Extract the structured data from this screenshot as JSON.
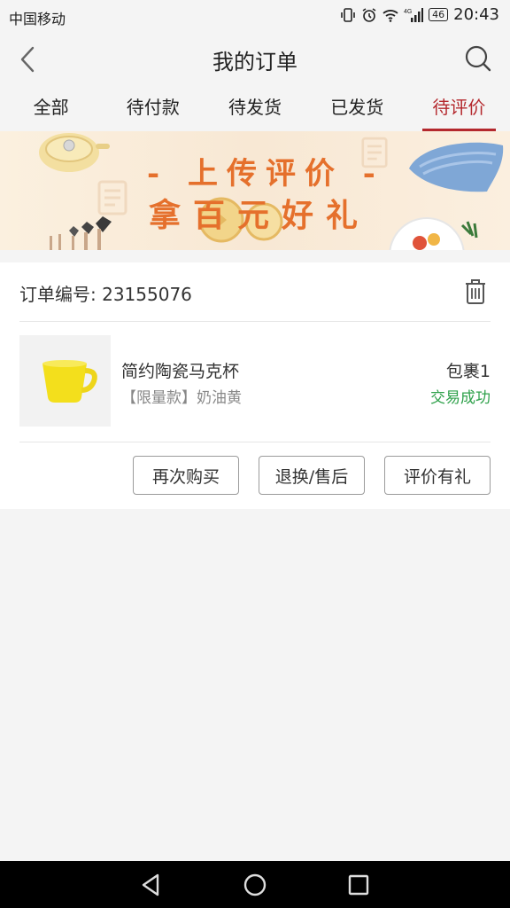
{
  "status_bar": {
    "carrier": "中国移动",
    "network": "4G",
    "battery": "46",
    "time": "20:43"
  },
  "header": {
    "title": "我的订单"
  },
  "tabs": [
    {
      "label": "全部",
      "active": false
    },
    {
      "label": "待付款",
      "active": false
    },
    {
      "label": "待发货",
      "active": false
    },
    {
      "label": "已发货",
      "active": false
    },
    {
      "label": "待评价",
      "active": true
    }
  ],
  "banner": {
    "line1": "- 上传评价 -",
    "line2": "拿百元好礼"
  },
  "order": {
    "number_label": "订单编号: 23155076",
    "item": {
      "name": "简约陶瓷马克杯",
      "spec": "【限量款】奶油黄",
      "package": "包裹1",
      "status": "交易成功"
    },
    "actions": {
      "rebuy": "再次购买",
      "return": "退换/售后",
      "review": "评价有礼"
    }
  },
  "colors": {
    "accent": "#b4282d",
    "banner_text": "#e5702c",
    "success": "#2fa14b"
  },
  "icons": [
    "back-icon",
    "search-icon",
    "trash-icon",
    "nav-back-icon",
    "nav-home-icon",
    "nav-recents-icon"
  ]
}
